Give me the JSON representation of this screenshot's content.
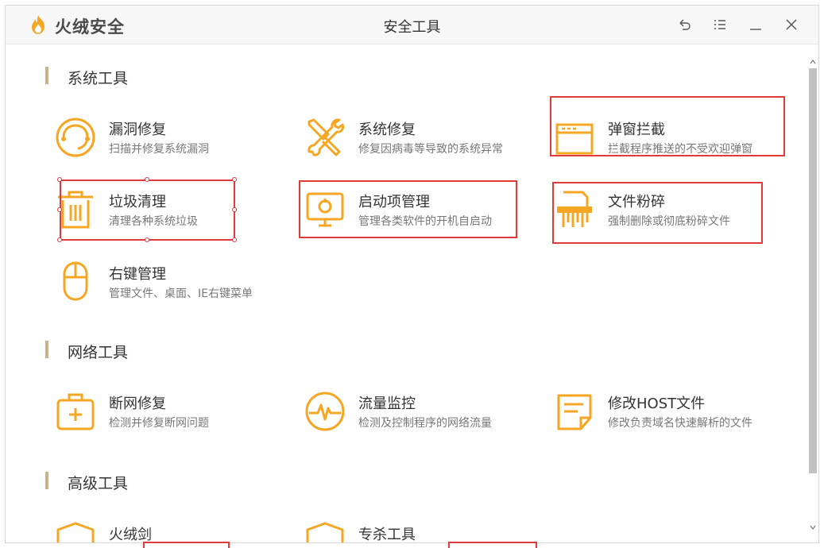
{
  "app": {
    "brand": "火绒安全",
    "window_title": "安全工具"
  },
  "colors": {
    "accent": "#f5a623",
    "highlight": "#e03a3a",
    "section_bar": "#c9b38f"
  },
  "sections": [
    {
      "label": "系统工具",
      "tools": [
        {
          "name": "漏洞修复",
          "desc": "扫描并修复系统漏洞",
          "icon": "vulnerability-repair-icon"
        },
        {
          "name": "系统修复",
          "desc": "修复因病毒等导致的系统异常",
          "icon": "system-repair-icon"
        },
        {
          "name": "弹窗拦截",
          "desc": "拦截程序推送的不受欢迎弹窗",
          "icon": "popup-block-icon"
        },
        {
          "name": "垃圾清理",
          "desc": "清理各种系统垃圾",
          "icon": "trash-icon"
        },
        {
          "name": "启动项管理",
          "desc": "管理各类软件的开机自启动",
          "icon": "startup-monitor-icon"
        },
        {
          "name": "文件粉碎",
          "desc": "强制删除或彻底粉碎文件",
          "icon": "shredder-icon"
        },
        {
          "name": "右键管理",
          "desc": "管理文件、桌面、IE右键菜单",
          "icon": "mouse-icon"
        }
      ]
    },
    {
      "label": "网络工具",
      "tools": [
        {
          "name": "断网修复",
          "desc": "检测并修复断网问题",
          "icon": "network-repair-icon"
        },
        {
          "name": "流量监控",
          "desc": "检测及控制程序的网络流量",
          "icon": "traffic-monitor-icon"
        },
        {
          "name": "修改HOST文件",
          "desc": "修改负责域名快速解析的文件",
          "icon": "host-file-icon"
        }
      ]
    },
    {
      "label": "高级工具",
      "tools": [
        {
          "name": "火绒剑",
          "icon": "huorong-sword-icon"
        },
        {
          "name": "专杀工具",
          "icon": "special-kill-icon"
        }
      ]
    }
  ]
}
